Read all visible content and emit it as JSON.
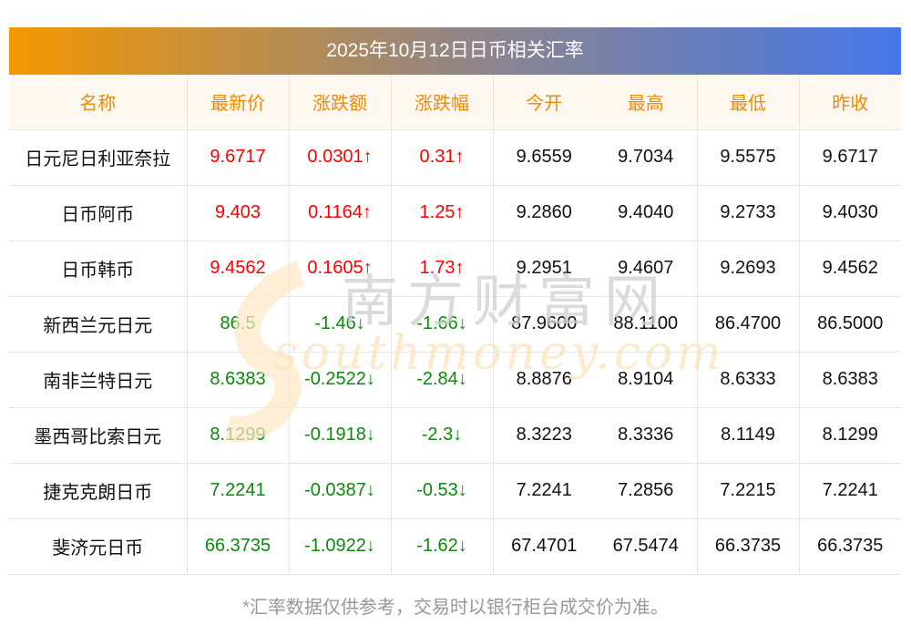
{
  "title": "2025年10月12日日币相关汇率",
  "headers": [
    "名称",
    "最新价",
    "涨跌额",
    "涨跌幅",
    "今开",
    "最高",
    "最低",
    "昨收"
  ],
  "rows": [
    {
      "name": "日元尼日利亚奈拉",
      "dir": "up",
      "latest": "9.6717",
      "change": "0.0301↑",
      "pct": "0.31↑",
      "open": "9.6559",
      "high": "9.7034",
      "low": "9.5575",
      "prev": "9.6717"
    },
    {
      "name": "日币阿币",
      "dir": "up",
      "latest": "9.403",
      "change": "0.1164↑",
      "pct": "1.25↑",
      "open": "9.2860",
      "high": "9.4040",
      "low": "9.2733",
      "prev": "9.4030"
    },
    {
      "name": "日币韩币",
      "dir": "up",
      "latest": "9.4562",
      "change": "0.1605↑",
      "pct": "1.73↑",
      "open": "9.2951",
      "high": "9.4607",
      "low": "9.2693",
      "prev": "9.4562"
    },
    {
      "name": "新西兰元日元",
      "dir": "down",
      "latest": "86.5",
      "change": "-1.46↓",
      "pct": "-1.66↓",
      "open": "87.9600",
      "high": "88.1100",
      "low": "86.4700",
      "prev": "86.5000"
    },
    {
      "name": "南非兰特日元",
      "dir": "down",
      "latest": "8.6383",
      "change": "-0.2522↓",
      "pct": "-2.84↓",
      "open": "8.8876",
      "high": "8.9104",
      "low": "8.6333",
      "prev": "8.6383"
    },
    {
      "name": "墨西哥比索日元",
      "dir": "down",
      "latest": "8.1299",
      "change": "-0.1918↓",
      "pct": "-2.3↓",
      "open": "8.3223",
      "high": "8.3336",
      "low": "8.1149",
      "prev": "8.1299"
    },
    {
      "name": "捷克克朗日币",
      "dir": "down",
      "latest": "7.2241",
      "change": "-0.0387↓",
      "pct": "-0.53↓",
      "open": "7.2241",
      "high": "7.2856",
      "low": "7.2215",
      "prev": "7.2241"
    },
    {
      "name": "斐济元日币",
      "dir": "down",
      "latest": "66.3735",
      "change": "-1.0922↓",
      "pct": "-1.62↓",
      "open": "67.4701",
      "high": "67.5474",
      "low": "66.3735",
      "prev": "66.3735"
    }
  ],
  "watermark": {
    "cn": "南方财富网",
    "en": "southmoney.com"
  },
  "footer": "*汇率数据仅供参考，交易时以银行柜台成交价为准。",
  "colors": {
    "up": "#ff0000",
    "down": "#0b8a0b",
    "header": "#f08a00"
  }
}
